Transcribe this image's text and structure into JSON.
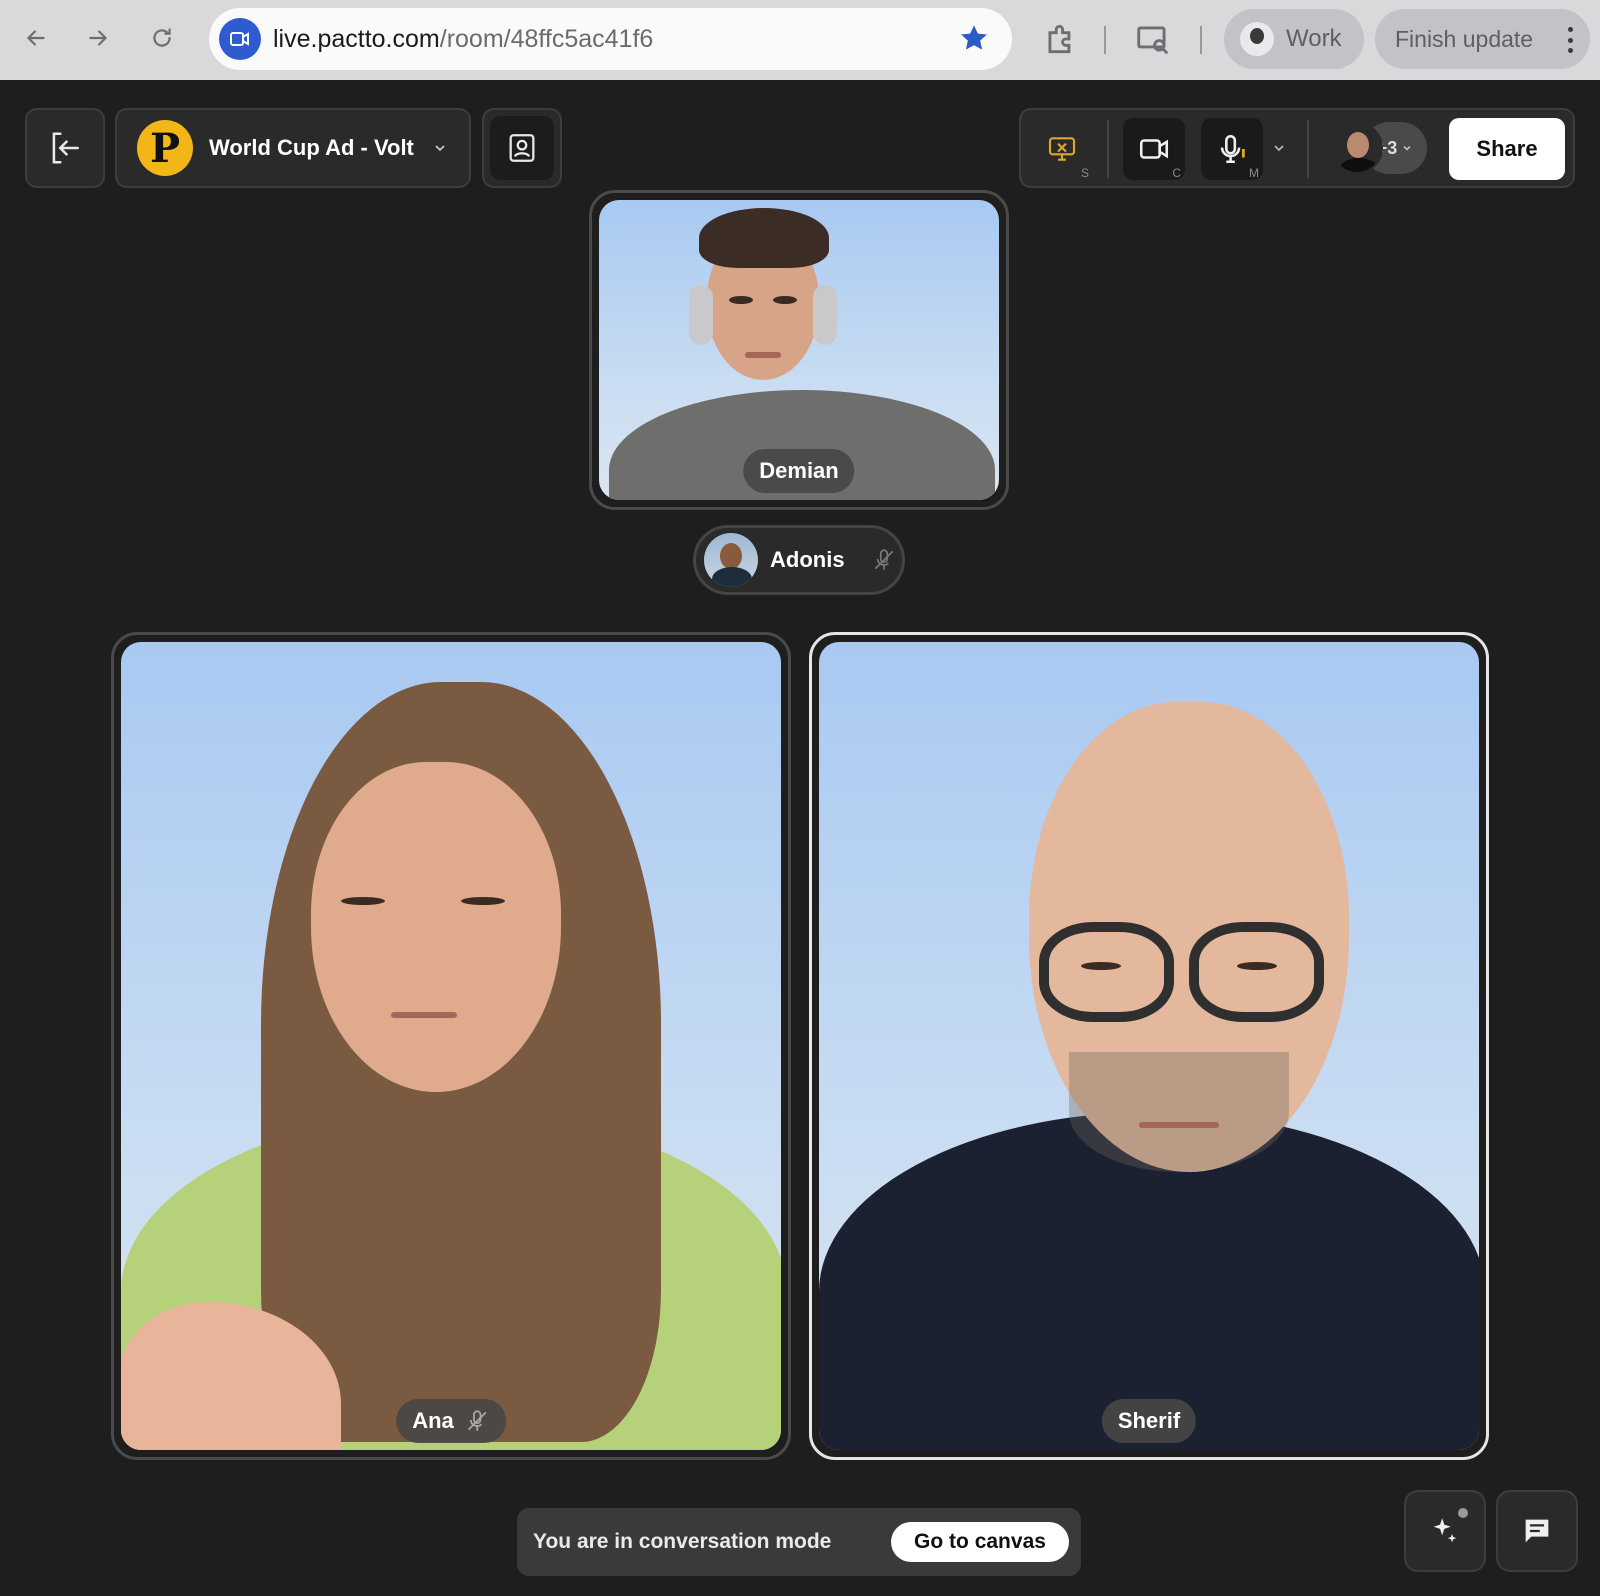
{
  "browser": {
    "url_host": "live.pactto.com",
    "url_path": "/room/48ffc5ac41f6",
    "profile_label": "Work",
    "update_label": "Finish update"
  },
  "room": {
    "title": "World Cup Ad - Volt",
    "logo_letter": "P"
  },
  "media": {
    "screen_hint": "S",
    "camera_hint": "C",
    "mic_hint": "M",
    "more_count": "+3",
    "share_label": "Share"
  },
  "participants": {
    "demian": "Demian",
    "adonis": "Adonis",
    "ana": "Ana",
    "sherif": "Sherif"
  },
  "bottom": {
    "mode_text": "You are in conversation mode",
    "canvas_button": "Go to canvas"
  },
  "colors": {
    "background": "#1e1e1e",
    "accent_logo": "#f3b619",
    "screen_share_icon": "#e0a62a"
  }
}
